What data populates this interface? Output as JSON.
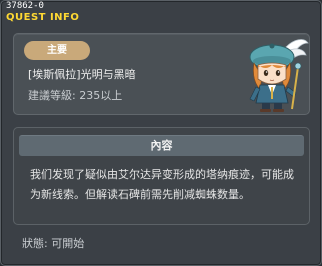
{
  "window": {
    "quest_id": "37862-0",
    "title": "QUEST INFO"
  },
  "quest": {
    "badge": "主要",
    "name": "[埃斯佩拉]光明与黑暗",
    "level": "建議等級: 235以上"
  },
  "content": {
    "header": "內容",
    "body": "我们发现了疑似由艾尔达异变形成的塔纳痕迹，可能成为新线索。但解读石碑前需先削减蜘蛛数量。"
  },
  "status": "狀態: 可開始",
  "colors": {
    "title": "#ffd933",
    "badge": "#c9a97a",
    "npc_hat": "#5aa6b0",
    "npc_hair": "#e08a3a"
  },
  "icons": {
    "npc": "npc-character-icon"
  }
}
